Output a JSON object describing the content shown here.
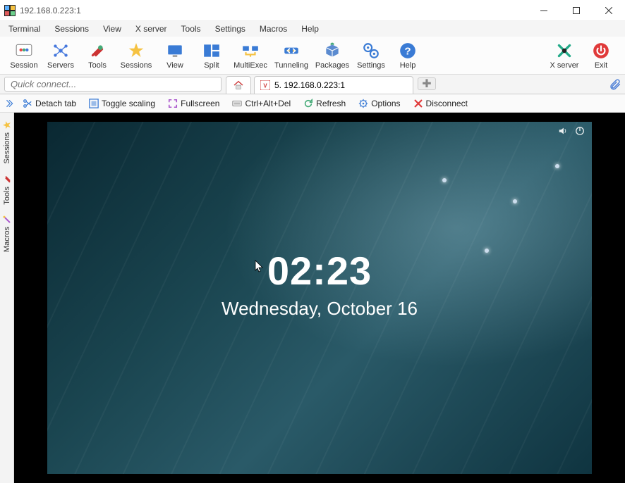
{
  "window": {
    "title": "192.168.0.223:1"
  },
  "menus": [
    "Terminal",
    "Sessions",
    "View",
    "X server",
    "Tools",
    "Settings",
    "Macros",
    "Help"
  ],
  "toolbar": {
    "session": "Session",
    "servers": "Servers",
    "tools": "Tools",
    "sessions": "Sessions",
    "view": "View",
    "split": "Split",
    "multiexec": "MultiExec",
    "tunneling": "Tunneling",
    "packages": "Packages",
    "settings": "Settings",
    "help": "Help",
    "xserver": "X server",
    "exit": "Exit"
  },
  "quick_connect": {
    "placeholder": "Quick connect..."
  },
  "tab": {
    "label": "5. 192.168.0.223:1"
  },
  "actions": {
    "detach": "Detach tab",
    "togglescaling": "Toggle scaling",
    "fullscreen": "Fullscreen",
    "ctrlaltdel": "Ctrl+Alt+Del",
    "refresh": "Refresh",
    "options": "Options",
    "disconnect": "Disconnect"
  },
  "side": {
    "sessions": "Sessions",
    "tools": "Tools",
    "macros": "Macros"
  },
  "desktop": {
    "time": "02:23",
    "date": "Wednesday, October 16"
  }
}
